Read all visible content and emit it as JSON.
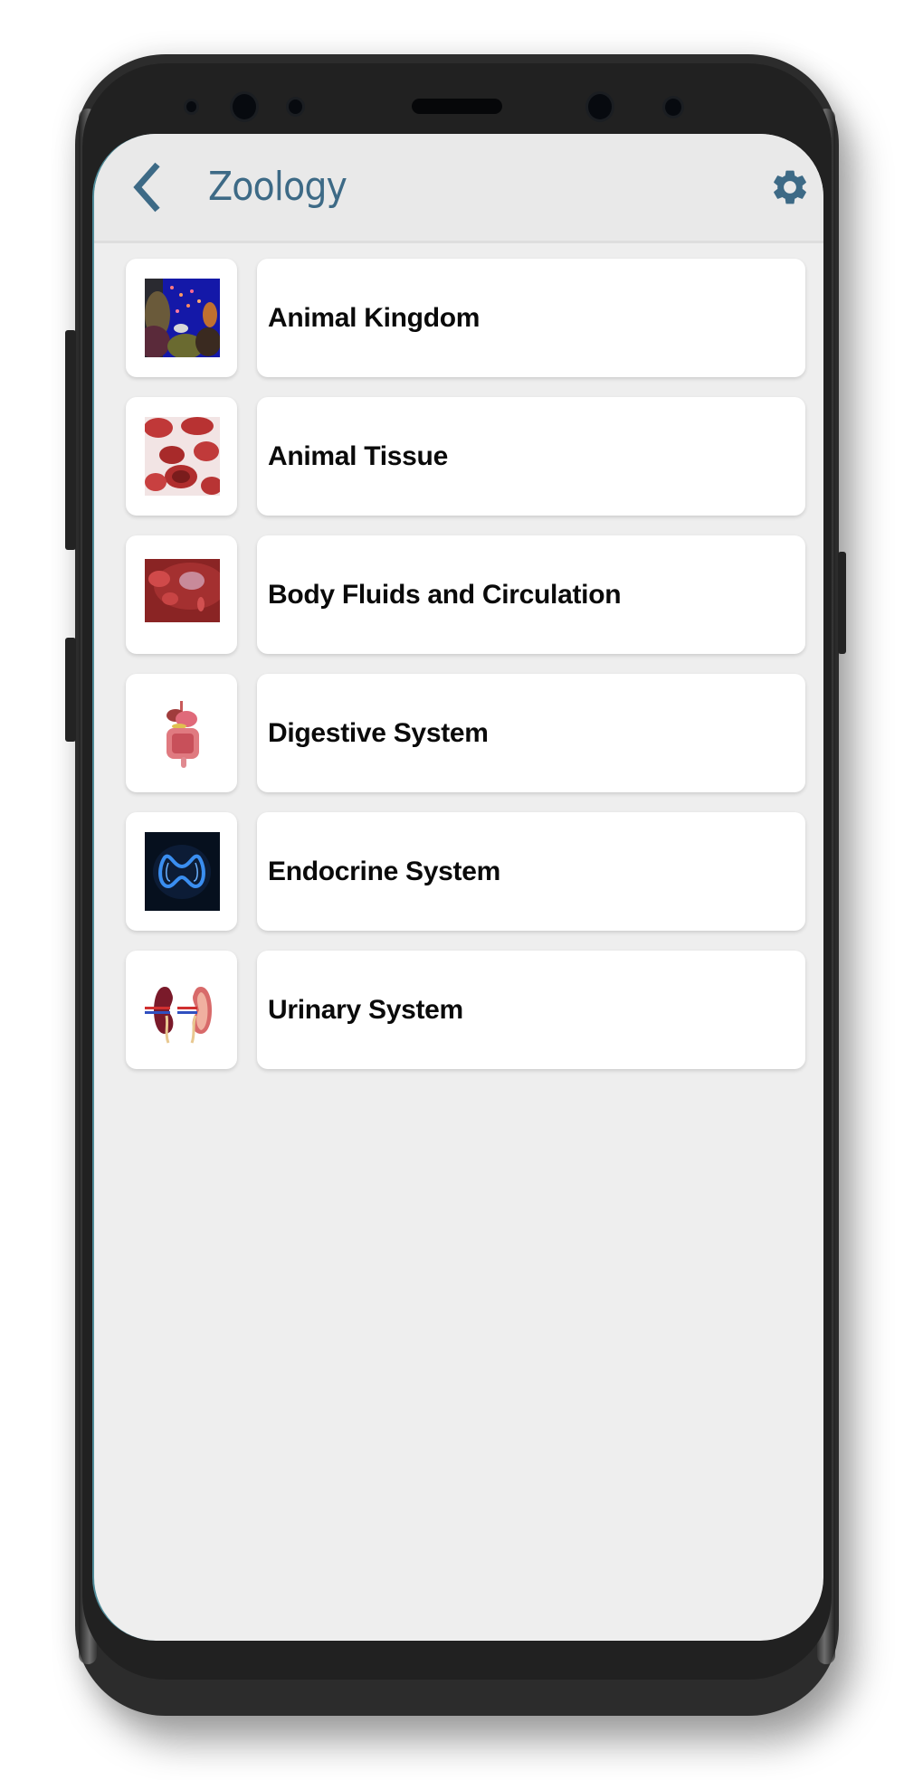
{
  "header": {
    "title": "Zoology",
    "back_icon": "chevron-left-icon",
    "settings_icon": "gear-icon",
    "accent_color": "#3d6a86"
  },
  "topics": [
    {
      "label": "Animal Kingdom",
      "thumbnail": "coral-reef-fish-image"
    },
    {
      "label": "Animal Tissue",
      "thumbnail": "red-blood-cells-image"
    },
    {
      "label": "Body Fluids and Circulation",
      "thumbnail": "blood-vessel-image"
    },
    {
      "label": "Digestive System",
      "thumbnail": "digestive-organs-image"
    },
    {
      "label": "Endocrine System",
      "thumbnail": "thyroid-gland-image"
    },
    {
      "label": "Urinary System",
      "thumbnail": "kidneys-image"
    }
  ]
}
